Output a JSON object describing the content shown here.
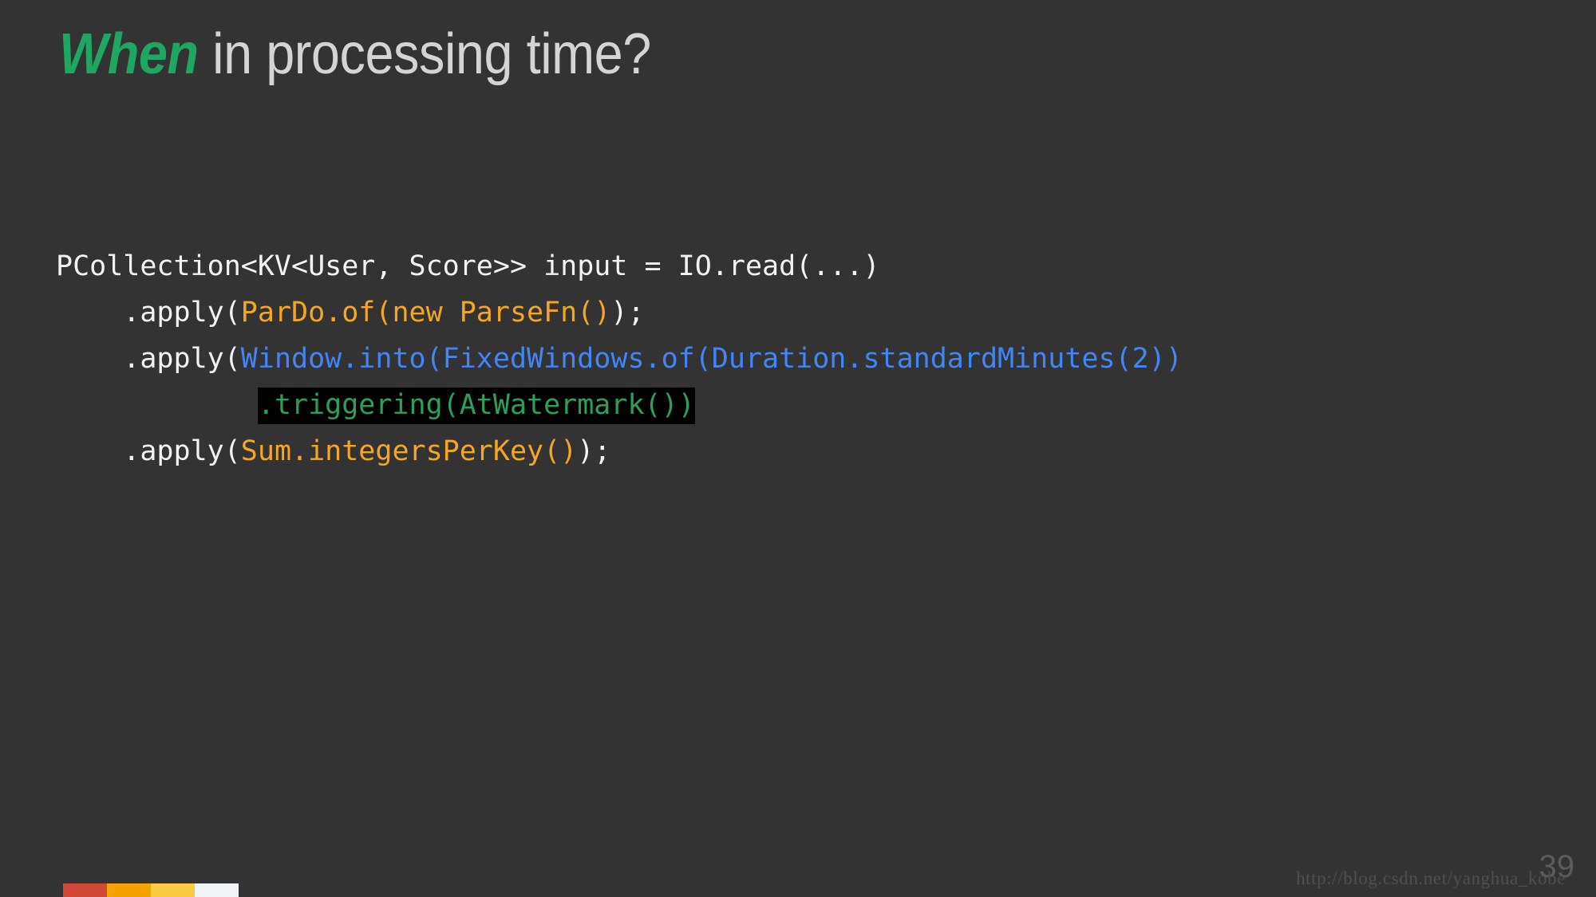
{
  "slide": {
    "background_color": "#333333",
    "title": {
      "accent_text": "When",
      "accent_color": "#1DA762",
      "rest_text": " in processing time?",
      "rest_color": "#D4D4D4"
    },
    "code": {
      "language": "java",
      "lines": [
        {
          "id": "line-1",
          "tokens": [
            {
              "text": "PCollection<KV<User, Score>> input = IO.read(...)",
              "style": "plain"
            }
          ]
        },
        {
          "id": "line-2",
          "tokens": [
            {
              "text": "    .apply(",
              "style": "plain"
            },
            {
              "text": "ParDo.of(new ParseFn()",
              "style": "orange"
            },
            {
              "text": ");",
              "style": "plain"
            }
          ]
        },
        {
          "id": "line-3",
          "tokens": [
            {
              "text": "    .apply(",
              "style": "plain"
            },
            {
              "text": "Window.into(FixedWindows.of(Duration.standardMinutes(2))",
              "style": "blue"
            }
          ]
        },
        {
          "id": "line-4",
          "tokens": [
            {
              "text": "            ",
              "style": "plain"
            },
            {
              "text": ".triggering(AtWatermark())",
              "style": "green-highlight"
            }
          ]
        },
        {
          "id": "line-5",
          "tokens": [
            {
              "text": "    .apply(",
              "style": "plain"
            },
            {
              "text": "Sum.integersPerKey()",
              "style": "orange"
            },
            {
              "text": ");",
              "style": "plain"
            }
          ]
        }
      ],
      "colors": {
        "plain": "#F2F2F2",
        "orange": "#F5A623",
        "blue": "#4285F4",
        "green": "#2CA05A",
        "highlight_background": "#000000"
      }
    },
    "color_bars": [
      {
        "name": "bar-red",
        "color": "#D14836"
      },
      {
        "name": "bar-orange",
        "color": "#F5A302"
      },
      {
        "name": "bar-yellow",
        "color": "#FBCB43"
      },
      {
        "name": "bar-white",
        "color": "#F2F3F5"
      }
    ],
    "footer": {
      "page_number": "39",
      "watermark": "http://blog.csdn.net/yanghua_kobe"
    }
  }
}
